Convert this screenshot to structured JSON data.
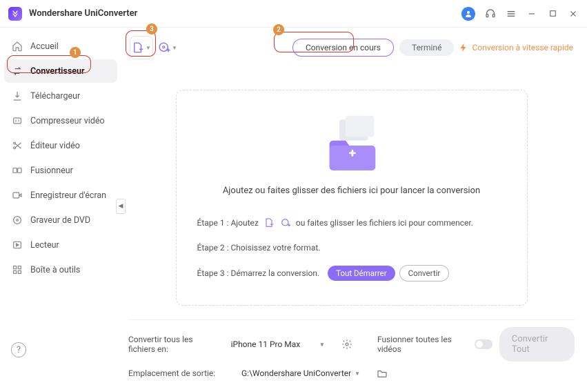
{
  "app": {
    "title": "Wondershare UniConverter"
  },
  "sidebar": {
    "items": [
      {
        "label": "Accueil"
      },
      {
        "label": "Convertisseur"
      },
      {
        "label": "Téléchargeur"
      },
      {
        "label": "Compresseur vidéo"
      },
      {
        "label": "Éditeur vidéo"
      },
      {
        "label": "Fusionneur"
      },
      {
        "label": "Enregistreur d'écran"
      },
      {
        "label": "Graveur de DVD"
      },
      {
        "label": "Lecteur"
      },
      {
        "label": "Boîte à outils"
      }
    ]
  },
  "tabs": {
    "active": "Conversion en cours",
    "inactive": "Terminé"
  },
  "speed_note": "Conversion à vitesse rapide",
  "dropzone": {
    "headline": "Ajoutez ou faites glisser des fichiers ici pour lancer la conversion",
    "step1_prefix": "Étape 1 : Ajoutez",
    "step1_suffix": "ou faites glisser les fichiers ici pour commencer.",
    "step2": "Étape 2 : Choisissez votre format.",
    "step3": "Étape 3 : Démarrez la conversion.",
    "btn_start_all": "Tout Démarrer",
    "btn_convert": "Convertir"
  },
  "bottom": {
    "convert_all_label": "Convertir tous les fichiers en:",
    "convert_all_value": "iPhone 11 Pro Max",
    "merge_label": "Fusionner toutes les vidéos",
    "output_label": "Emplacement de sortie:",
    "output_value": "G:\\Wondershare UniConverter",
    "convert_all_btn": "Convertir Tout"
  },
  "annotations": {
    "b1": "1",
    "b2": "2",
    "b3": "3"
  }
}
